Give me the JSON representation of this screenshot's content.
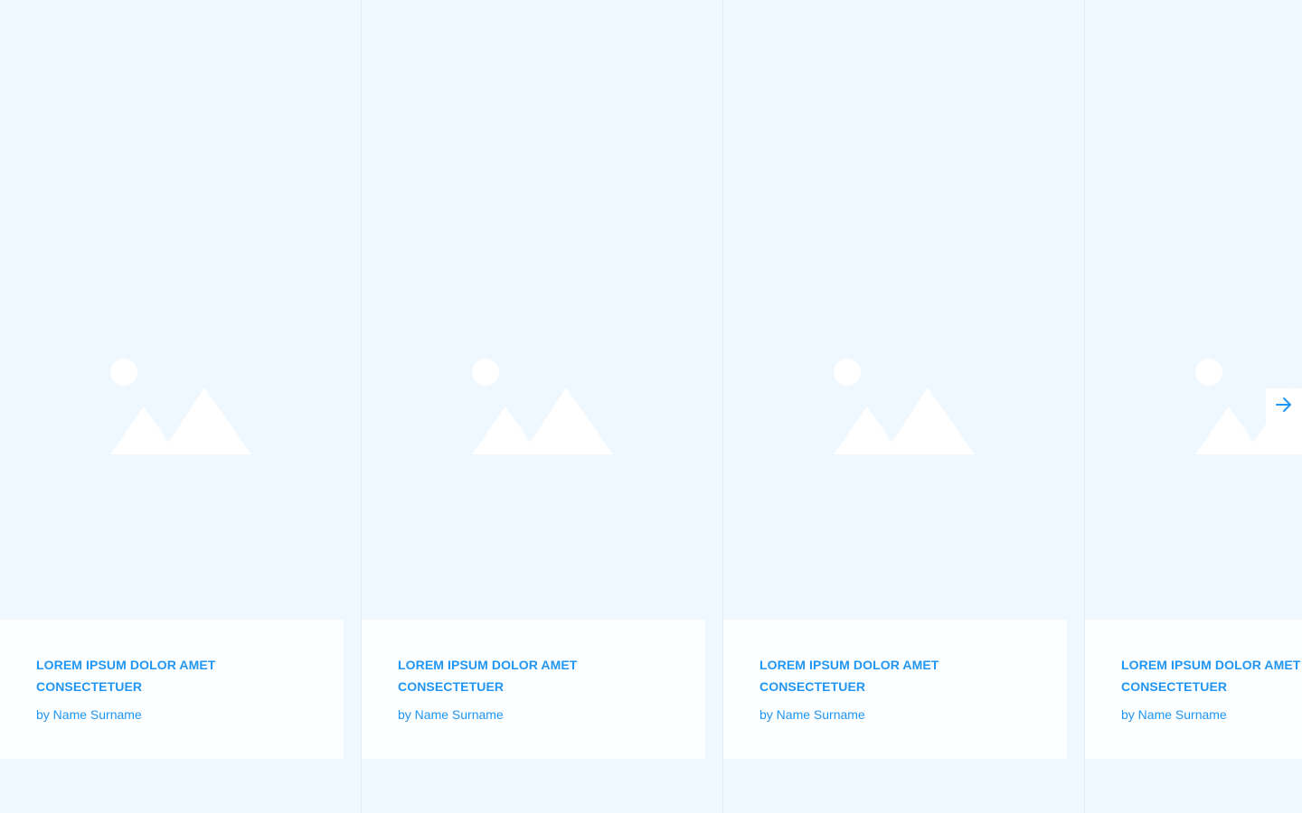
{
  "carousel": {
    "items": [
      {
        "title_line1": "LOREM IPSUM DOLOR AMET",
        "title_line2": "CONSECTETUER",
        "byline": "by Name Surname",
        "image_icon": "image-placeholder-icon"
      },
      {
        "title_line1": "LOREM IPSUM DOLOR AMET",
        "title_line2": "CONSECTETUER",
        "byline": "by Name Surname",
        "image_icon": "image-placeholder-icon"
      },
      {
        "title_line1": "LOREM IPSUM DOLOR AMET",
        "title_line2": "CONSECTETUER",
        "byline": "by Name Surname",
        "image_icon": "image-placeholder-icon"
      },
      {
        "title_line1": "LOREM IPSUM DOLOR AMET",
        "title_line2": "CONSECTETUER",
        "byline": "by Name Surname",
        "image_icon": "image-placeholder-icon"
      }
    ],
    "next_icon": "arrow-right-icon"
  },
  "colors": {
    "background": "#eff7ff",
    "card_background": "#fcfeff",
    "accent": "#2196f3",
    "placeholder_shape": "#ffffff"
  }
}
